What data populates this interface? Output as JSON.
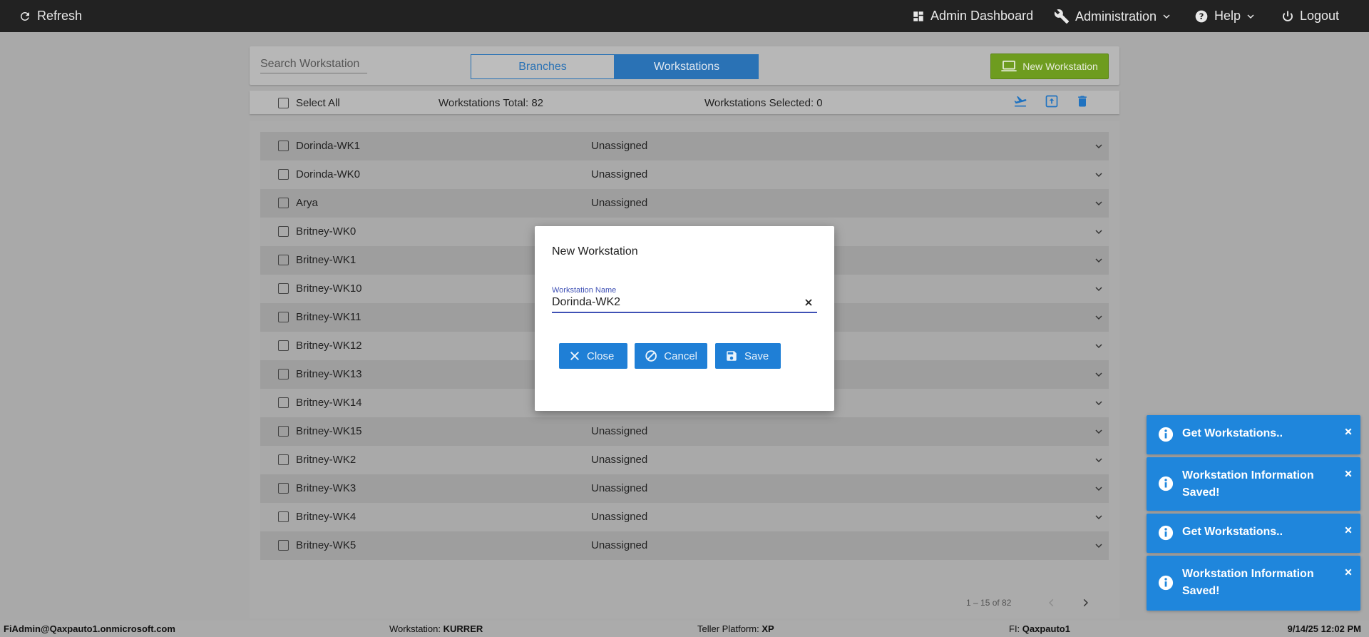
{
  "topbar": {
    "refresh": "Refresh",
    "admin_dashboard": "Admin Dashboard",
    "administration": "Administration",
    "help": "Help",
    "logout": "Logout"
  },
  "toolbar": {
    "search_placeholder": "Search Workstation",
    "tab_branches": "Branches",
    "tab_workstations": "Workstations",
    "new_workstation": "New Workstation"
  },
  "summary": {
    "select_all": "Select All",
    "total": "Workstations Total: 82",
    "selected": "Workstations Selected: 0"
  },
  "rows": [
    {
      "name": "Dorinda-WK1",
      "status": "Unassigned"
    },
    {
      "name": "Dorinda-WK0",
      "status": "Unassigned"
    },
    {
      "name": "Arya",
      "status": "Unassigned"
    },
    {
      "name": "Britney-WK0",
      "status": ""
    },
    {
      "name": "Britney-WK1",
      "status": ""
    },
    {
      "name": "Britney-WK10",
      "status": ""
    },
    {
      "name": "Britney-WK11",
      "status": ""
    },
    {
      "name": "Britney-WK12",
      "status": ""
    },
    {
      "name": "Britney-WK13",
      "status": ""
    },
    {
      "name": "Britney-WK14",
      "status": ""
    },
    {
      "name": "Britney-WK15",
      "status": "Unassigned"
    },
    {
      "name": "Britney-WK2",
      "status": "Unassigned"
    },
    {
      "name": "Britney-WK3",
      "status": "Unassigned"
    },
    {
      "name": "Britney-WK4",
      "status": "Unassigned"
    },
    {
      "name": "Britney-WK5",
      "status": "Unassigned"
    }
  ],
  "pager": {
    "label": "1 – 15 of 82"
  },
  "modal": {
    "title": "New Workstation",
    "field_label": "Workstation Name",
    "field_value": "Dorinda-WK2",
    "close": "Close",
    "cancel": "Cancel",
    "save": "Save"
  },
  "toasts": [
    {
      "text": "Get Workstations.."
    },
    {
      "text": "Workstation Information Saved!"
    },
    {
      "text": "Get Workstations.."
    },
    {
      "text": "Workstation Information Saved!"
    }
  ],
  "footer": {
    "user": "FiAdmin@Qaxpauto1.onmicrosoft.com",
    "workstation_label": "Workstation:",
    "workstation_value": "KURRER",
    "platform_label": "Teller Platform:",
    "platform_value": "XP",
    "fi_label": "FI:",
    "fi_value": "Qaxpauto1",
    "datetime": "9/14/25 12:02 PM"
  },
  "colors": {
    "primary": "#1f86dc",
    "new_button": "#6e9c1f",
    "topbar": "#222222"
  }
}
